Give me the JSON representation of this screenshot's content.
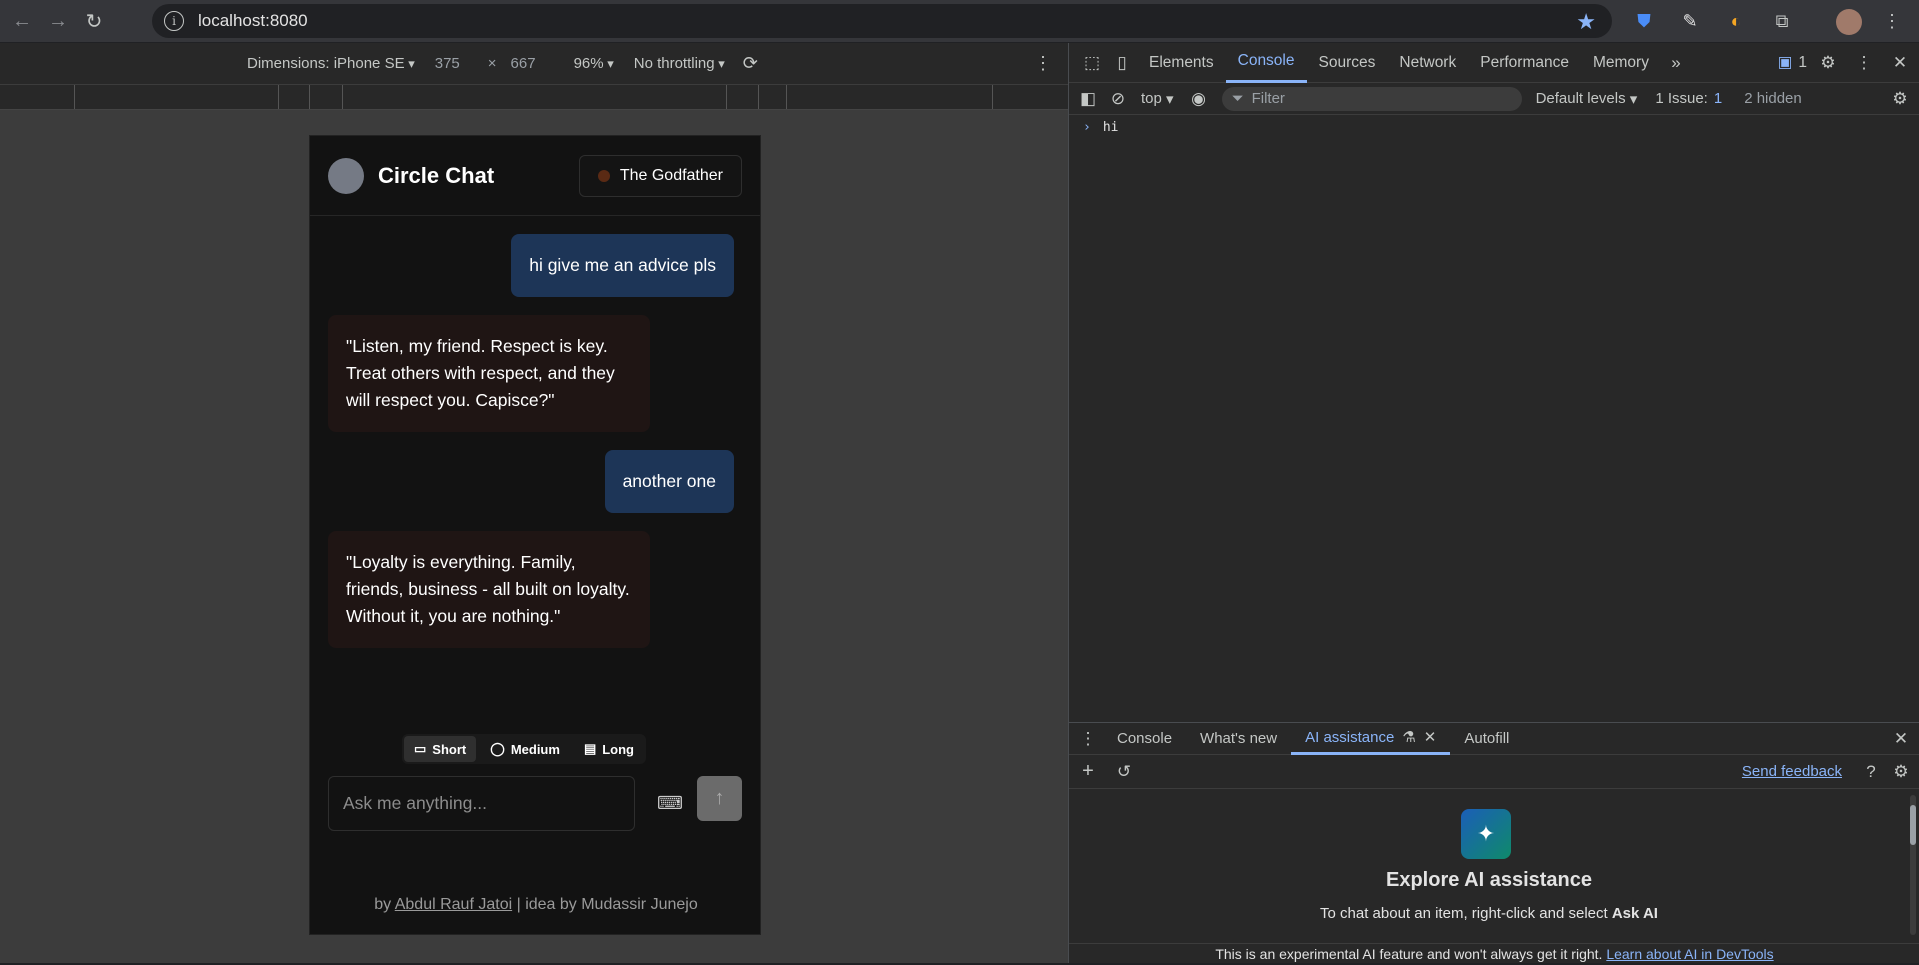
{
  "browser": {
    "url": "localhost:8080",
    "nav": {
      "back_icon": "←",
      "forward_icon": "→",
      "reload_icon": "↻"
    }
  },
  "emulation": {
    "device": "Dimensions: iPhone SE",
    "width": "375",
    "x": "×",
    "height": "667",
    "zoom": "96%",
    "throttling": "No throttling"
  },
  "app": {
    "title": "Circle Chat",
    "persona": "The Godfather",
    "messages": [
      {
        "role": "user",
        "text": "hi give me an advice pls"
      },
      {
        "role": "bot",
        "text": "\"Listen, my friend. Respect is key. Treat others with respect, and they will respect you. Capisce?\""
      },
      {
        "role": "user",
        "text": "another one"
      },
      {
        "role": "bot",
        "text": "\"Loyalty is everything. Family, friends, business - all built on loyalty. Without it, you are nothing.\""
      }
    ],
    "length_options": [
      "Short",
      "Medium",
      "Long"
    ],
    "selected_length": "Short",
    "input_placeholder": "Ask me anything...",
    "footer_prefix": "by ",
    "footer_author": "Abdul Rauf Jatoi",
    "footer_suffix": " | idea by Mudassir Junejo"
  },
  "devtools": {
    "tabs": [
      "Elements",
      "Console",
      "Sources",
      "Network",
      "Performance",
      "Memory"
    ],
    "selected_tab": "Console",
    "issues_badge": "1",
    "context": "top",
    "filter_placeholder": "Filter",
    "levels": "Default levels",
    "issues_label": "1 Issue:",
    "issues_count": "1",
    "hidden": "2 hidden",
    "console_lines": [
      "hi"
    ],
    "drawer_tabs": [
      "Console",
      "What's new",
      "AI assistance",
      "Autofill"
    ],
    "drawer_selected": "AI assistance",
    "send_feedback": "Send feedback",
    "ai_title": "Explore AI assistance",
    "ai_sub_prefix": "To chat about an item, right-click and select ",
    "ai_sub_bold": "Ask AI",
    "ai_footer_prefix": "This is an experimental AI feature and won't always get it right. ",
    "ai_footer_link": "Learn about AI in DevTools"
  }
}
